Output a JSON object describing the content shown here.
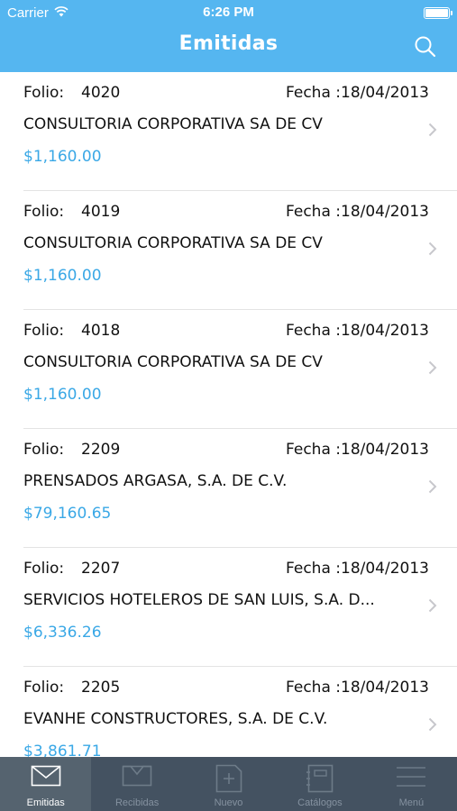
{
  "status_bar": {
    "carrier": "Carrier",
    "time": "6:26 PM"
  },
  "nav": {
    "title": "Emitidas"
  },
  "invoices": [
    {
      "folio_label": "Folio:",
      "folio": "4020",
      "fecha": "Fecha :18/04/2013",
      "name": "CONSULTORIA CORPORATIVA SA DE CV",
      "amount": "$1,160.00"
    },
    {
      "folio_label": "Folio:",
      "folio": "4019",
      "fecha": "Fecha :18/04/2013",
      "name": "CONSULTORIA CORPORATIVA SA DE CV",
      "amount": "$1,160.00"
    },
    {
      "folio_label": "Folio:",
      "folio": "4018",
      "fecha": "Fecha :18/04/2013",
      "name": "CONSULTORIA CORPORATIVA SA DE CV",
      "amount": "$1,160.00"
    },
    {
      "folio_label": "Folio:",
      "folio": "2209",
      "fecha": "Fecha :18/04/2013",
      "name": "PRENSADOS ARGASA, S.A. DE C.V.",
      "amount": "$79,160.65"
    },
    {
      "folio_label": "Folio:",
      "folio": "2207",
      "fecha": "Fecha :18/04/2013",
      "name": "SERVICIOS HOTELEROS DE SAN LUIS, S.A. D...",
      "amount": "$6,336.26"
    },
    {
      "folio_label": "Folio:",
      "folio": "2205",
      "fecha": "Fecha :18/04/2013",
      "name": "EVANHE CONSTRUCTORES, S.A. DE C.V.",
      "amount": "$3,861.71"
    }
  ],
  "tabs": [
    {
      "label": "Emitidas",
      "icon": "envelope-icon",
      "active": true
    },
    {
      "label": "Recibidas",
      "icon": "inbox-tray-icon",
      "active": false
    },
    {
      "label": "Nuevo",
      "icon": "new-document-icon",
      "active": false
    },
    {
      "label": "Catálogos",
      "icon": "catalog-icon",
      "active": false
    },
    {
      "label": "Menú",
      "icon": "menu-icon",
      "active": false
    }
  ],
  "colors": {
    "header": "#55b6f0",
    "amount": "#3aa8e6",
    "tabbar": "#445261",
    "tab_active": "#55636f"
  }
}
